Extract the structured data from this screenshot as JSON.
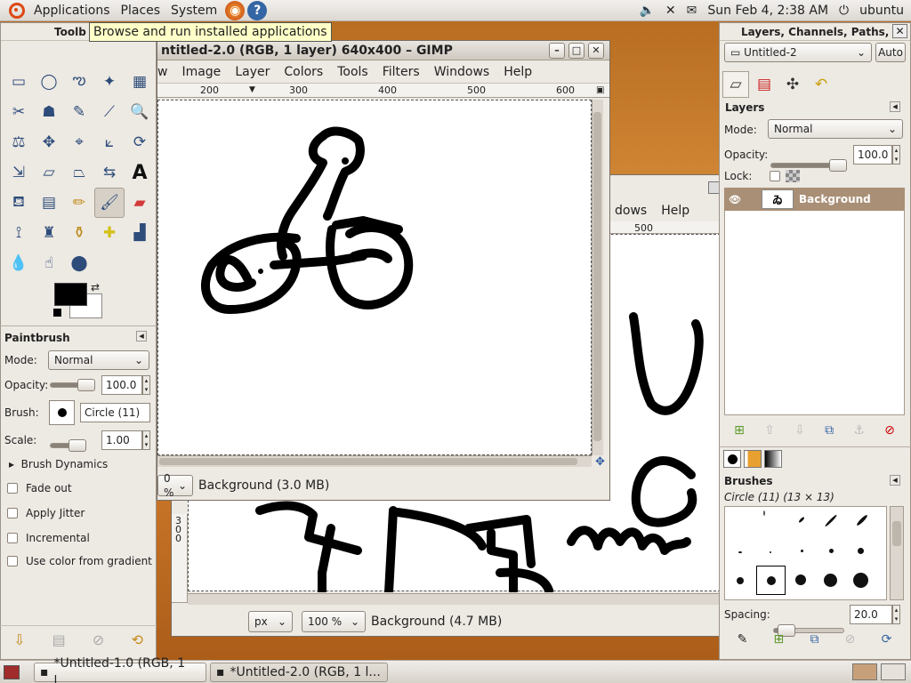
{
  "panel": {
    "menus": [
      "Applications",
      "Places",
      "System"
    ],
    "datetime": "Sun Feb  4,  2:38 AM",
    "user": "ubuntu"
  },
  "tooltip": "Browse and run installed applications",
  "toolbox": {
    "title": "Toolb",
    "tool_options_title": "Paintbrush",
    "mode_label": "Mode:",
    "mode_value": "Normal",
    "opacity_label": "Opacity:",
    "opacity_value": "100.0",
    "brush_label": "Brush:",
    "brush_value": "Circle (11)",
    "scale_label": "Scale:",
    "scale_value": "1.00",
    "brush_dynamics": "Brush Dynamics",
    "options": [
      "Fade out",
      "Apply Jitter",
      "Incremental",
      "Use color from gradient"
    ]
  },
  "back_window": {
    "menus": [
      "dows",
      "Help"
    ],
    "ruler_label": "500",
    "zoom_unit": "px",
    "zoom_value": "100 %",
    "status": "Background (4.7 MB)"
  },
  "front_window": {
    "title": "ntitled-2.0 (RGB, 1 layer) 640x400 – GIMP",
    "menus": [
      "w",
      "Image",
      "Layer",
      "Colors",
      "Tools",
      "Filters",
      "Windows",
      "Help"
    ],
    "ruler_labels": [
      "200",
      "300",
      "400",
      "500",
      "600"
    ],
    "zoom_value": "0 %",
    "status": "Background (3.0 MB)"
  },
  "layers_dock": {
    "title": "Layers, Channels, Paths, U",
    "image_select": "Untitled-2",
    "auto_button": "Auto",
    "layers_title": "Layers",
    "mode_label": "Mode:",
    "mode_value": "Normal",
    "opacity_label": "Opacity:",
    "opacity_value": "100.0",
    "lock_label": "Lock:",
    "layer_name": "Background",
    "brushes_title": "Brushes",
    "brush_name": "Circle (11) (13 × 13)",
    "spacing_label": "Spacing:",
    "spacing_value": "20.0"
  },
  "taskbar": {
    "tasks": [
      "*Untitled-1.0 (RGB, 1 l...",
      "*Untitled-2.0 (RGB, 1 l..."
    ]
  },
  "colors": {
    "foreground": "#000000",
    "background": "#ffffff",
    "layer_selected": "#a98f76"
  }
}
